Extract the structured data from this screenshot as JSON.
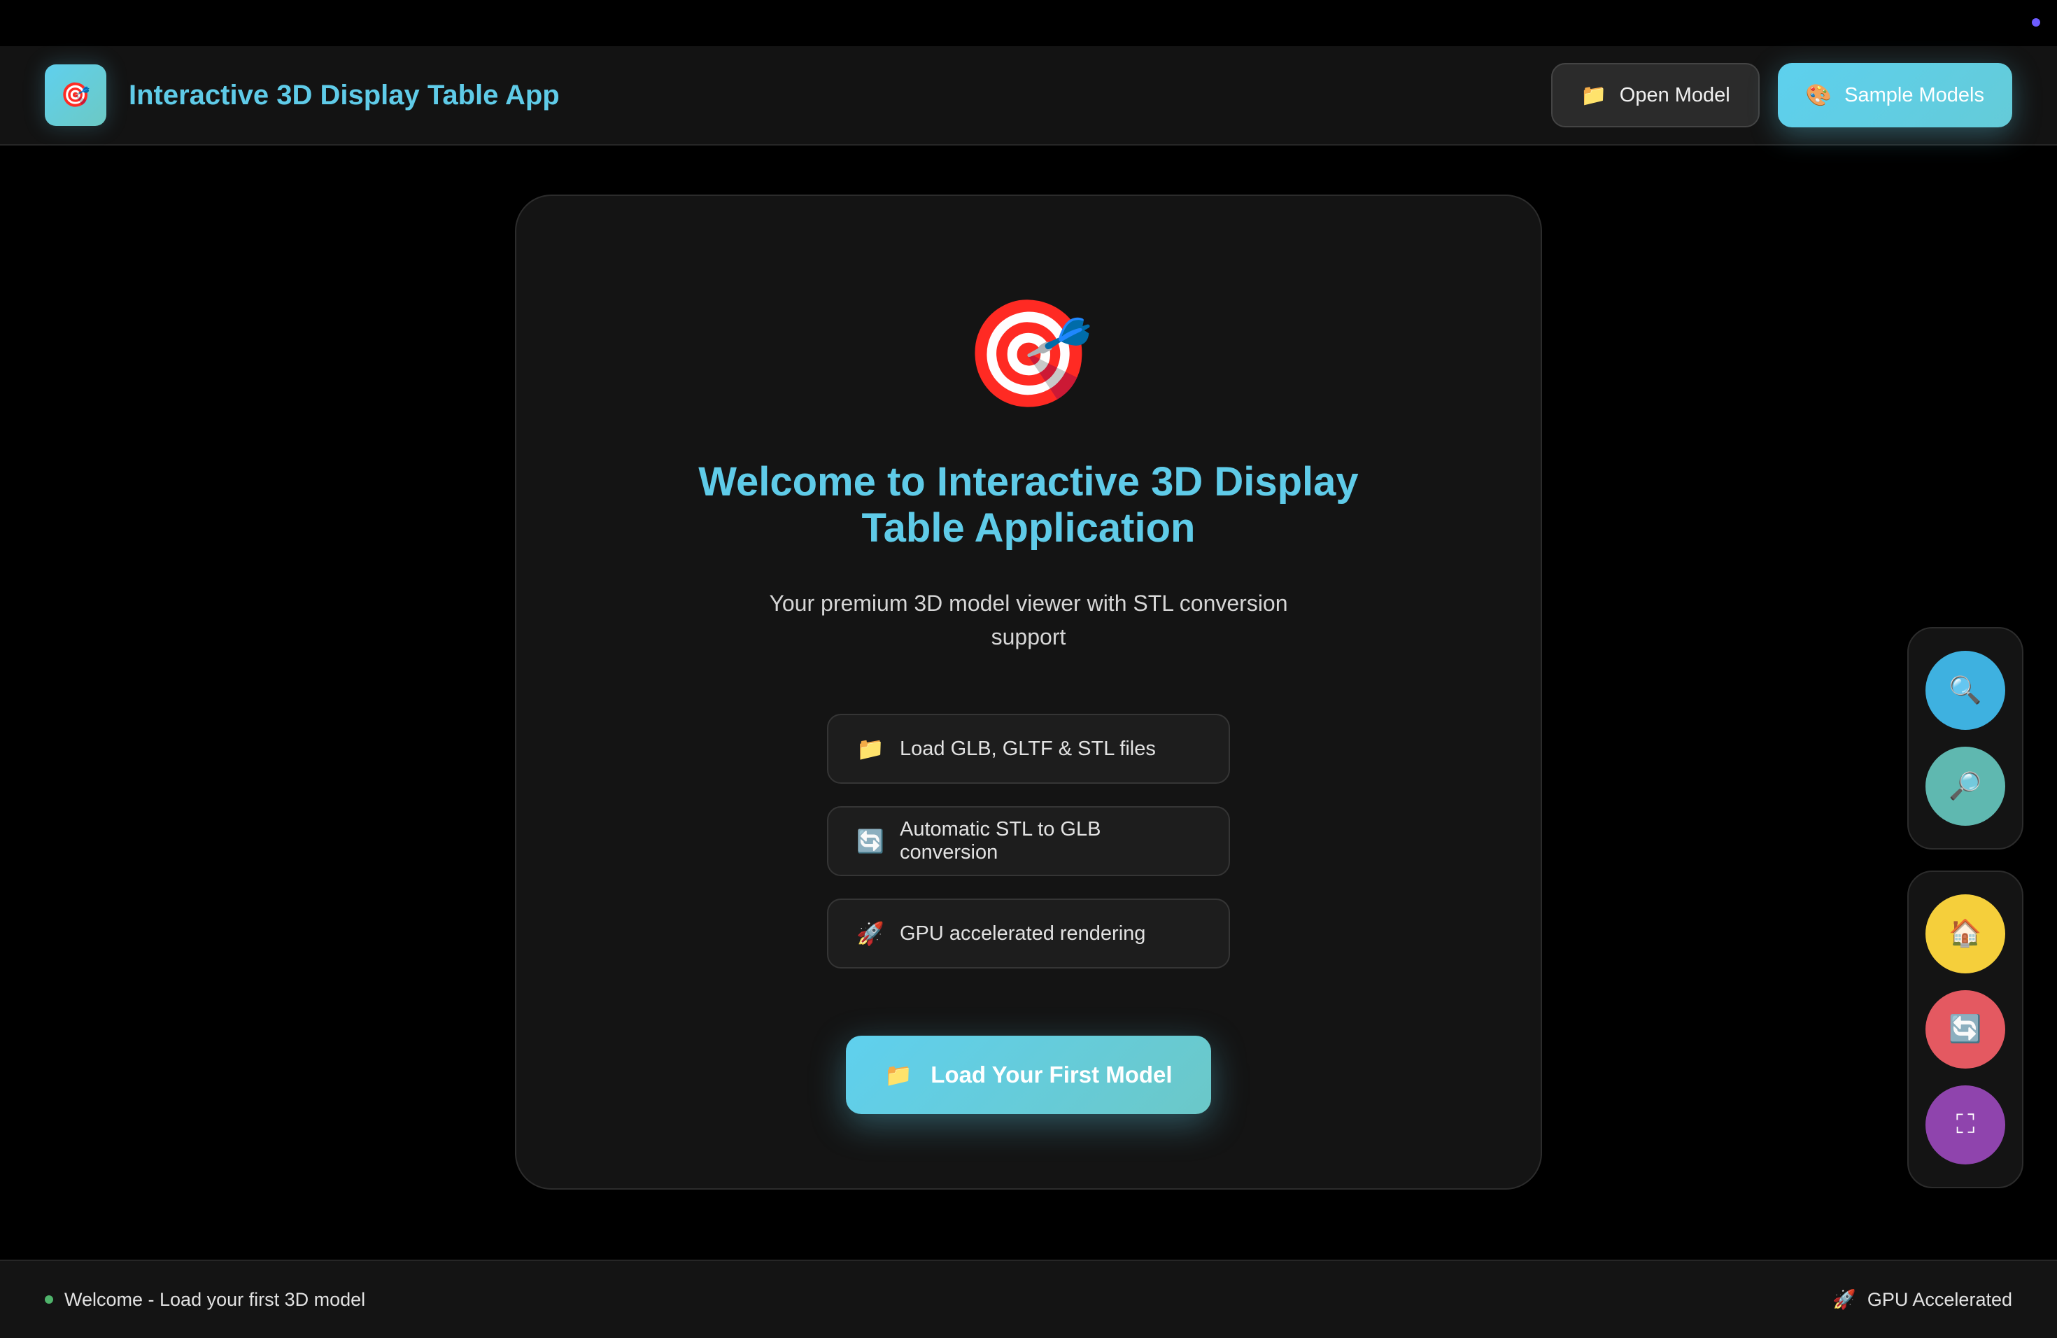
{
  "app": {
    "logo_icon": "🎯",
    "title": "Interactive 3D Display Table App"
  },
  "header": {
    "open_model": {
      "icon": "📁",
      "label": "Open Model"
    },
    "sample_models": {
      "icon": "🎨",
      "label": "Sample Models"
    }
  },
  "welcome": {
    "hero_icon": "🎯",
    "title": "Welcome to Interactive 3D Display Table Application",
    "subtitle": "Your premium 3D model viewer with STL conversion support",
    "features": [
      {
        "icon": "📁",
        "label": "Load GLB, GLTF & STL files"
      },
      {
        "icon": "🔄",
        "label": "Automatic STL to GLB conversion"
      },
      {
        "icon": "🚀",
        "label": "GPU accelerated rendering"
      }
    ],
    "cta": {
      "icon": "📁",
      "label": "Load Your First Model"
    }
  },
  "tools": {
    "zoom_in": {
      "icon": "🔍",
      "color": "#3eb1e0"
    },
    "zoom_out": {
      "icon": "🔎",
      "color": "#5fb8b0"
    },
    "home": {
      "icon": "🏠",
      "color": "#f5cf3b"
    },
    "reset": {
      "icon": "🔄",
      "color": "#e45961"
    },
    "fullscreen": {
      "icon": "⛶",
      "color": "#8f44ad"
    }
  },
  "status_bar": {
    "status_text": "Welcome - Load your first 3D model",
    "gpu_icon": "🚀",
    "gpu_text": "GPU Accelerated"
  },
  "colors": {
    "accent": "#5fcbe8",
    "background": "#000000",
    "panel": "#141414",
    "status_ok": "#4fb36b"
  }
}
